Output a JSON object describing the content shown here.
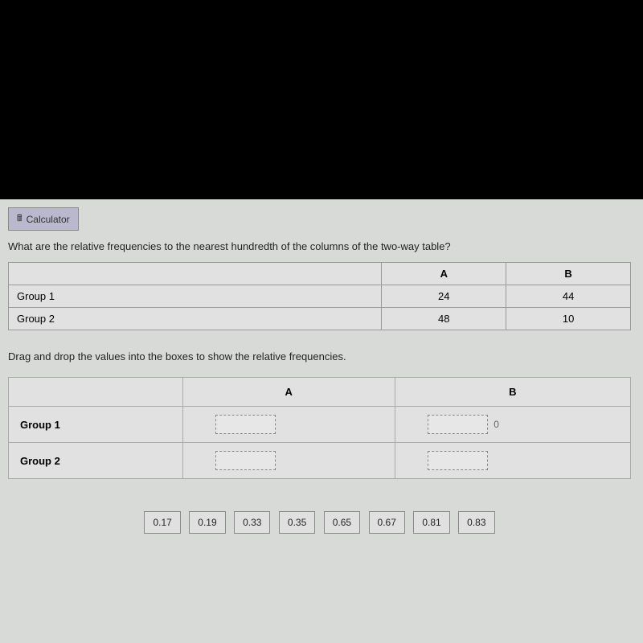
{
  "calculator": {
    "label": "Calculator"
  },
  "question": "What are the relative frequencies to the nearest hundredth of the columns of the two-way table?",
  "dataTable": {
    "headers": {
      "colA": "A",
      "colB": "B"
    },
    "rows": [
      {
        "label": "Group 1",
        "a": "24",
        "b": "44"
      },
      {
        "label": "Group 2",
        "a": "48",
        "b": "10"
      }
    ]
  },
  "instruction": "Drag and drop the values into the boxes to show the relative frequencies.",
  "answerTable": {
    "headers": {
      "colA": "A",
      "colB": "B"
    },
    "rows": [
      {
        "label": "Group 1",
        "zeroMark": "0"
      },
      {
        "label": "Group 2"
      }
    ]
  },
  "valueBank": [
    "0.17",
    "0.19",
    "0.33",
    "0.35",
    "0.65",
    "0.67",
    "0.81",
    "0.83"
  ]
}
